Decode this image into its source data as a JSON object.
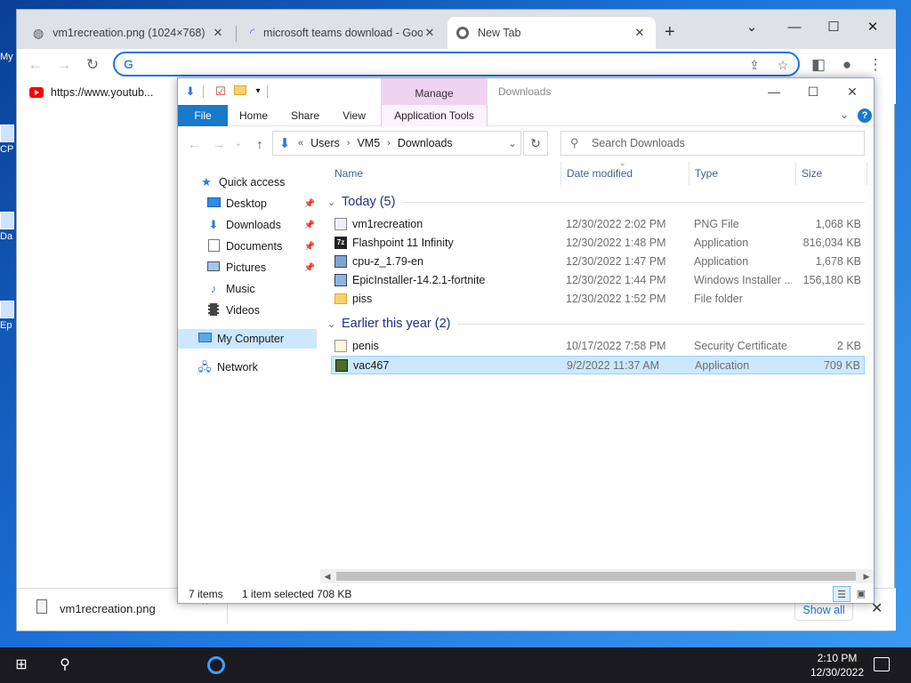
{
  "desktop": {
    "icons": [
      {
        "label": "My"
      },
      {
        "label": "CP"
      },
      {
        "label": "Da"
      },
      {
        "label": "Ep"
      }
    ]
  },
  "browser": {
    "tabs": [
      {
        "title": "vm1recreation.png (1024×768)",
        "icon": "globe-icon"
      },
      {
        "title": "microsoft teams download - Goo",
        "icon": "loading-spinner-icon"
      },
      {
        "title": "New Tab",
        "icon": "chrome-icon",
        "active": true
      }
    ],
    "new_tab_label": "+",
    "omnibox": {
      "value": ""
    },
    "bookmarks": [
      {
        "label": "https://www.youtub..."
      }
    ],
    "download": {
      "filename": "vm1recreation.png",
      "show_all": "Show all"
    }
  },
  "explorer": {
    "title": "Downloads",
    "manage_tab": "Manage",
    "ribbon_tabs": [
      "File",
      "Home",
      "Share",
      "View",
      "Application Tools"
    ],
    "breadcrumb": [
      "Users",
      "VM5",
      "Downloads"
    ],
    "breadcrumb_prefix": "«",
    "search_placeholder": "Search Downloads",
    "columns": {
      "name": "Name",
      "date": "Date modified",
      "type": "Type",
      "size": "Size"
    },
    "nav": {
      "quick_access": "Quick access",
      "items": [
        {
          "label": "Desktop",
          "pinned": true
        },
        {
          "label": "Downloads",
          "pinned": true
        },
        {
          "label": "Documents",
          "pinned": true
        },
        {
          "label": "Pictures",
          "pinned": true
        },
        {
          "label": "Music"
        },
        {
          "label": "Videos"
        }
      ],
      "my_computer": "My Computer",
      "network": "Network"
    },
    "groups": [
      {
        "label": "Today (5)",
        "files": [
          {
            "name": "vm1recreation",
            "date": "12/30/2022 2:02 PM",
            "type": "PNG File",
            "size": "1,068 KB",
            "icon": "png-file-icon"
          },
          {
            "name": "Flashpoint 11 Infinity",
            "date": "12/30/2022 1:48 PM",
            "type": "Application",
            "size": "816,034 KB",
            "icon": "7zip-app-icon"
          },
          {
            "name": "cpu-z_1.79-en",
            "date": "12/30/2022 1:47 PM",
            "type": "Application",
            "size": "1,678 KB",
            "icon": "installer-app-icon"
          },
          {
            "name": "EpicInstaller-14.2.1-fortnite",
            "date": "12/30/2022 1:44 PM",
            "type": "Windows Installer ...",
            "size": "156,180 KB",
            "icon": "msi-installer-icon"
          },
          {
            "name": "piss",
            "date": "12/30/2022 1:52 PM",
            "type": "File folder",
            "size": "",
            "icon": "folder-icon"
          }
        ]
      },
      {
        "label": "Earlier this year (2)",
        "files": [
          {
            "name": "penis",
            "date": "10/17/2022 7:58 PM",
            "type": "Security Certificate",
            "size": "2 KB",
            "icon": "certificate-icon"
          },
          {
            "name": "vac467",
            "date": "9/2/2022 11:37 AM",
            "type": "Application",
            "size": "709 KB",
            "icon": "app-icon",
            "selected": true
          }
        ]
      }
    ],
    "status": {
      "count": "7 items",
      "selected": "1 item selected",
      "size": "708 KB"
    }
  },
  "taskbar": {
    "time": "2:10 PM",
    "date": "12/30/2022"
  },
  "colors": {
    "accent": "#1a73e8",
    "file_tab": "#1979ca",
    "manage": "#f0d3f0",
    "selection": "#cce8ff",
    "taskbar": "#1b1b1f"
  }
}
